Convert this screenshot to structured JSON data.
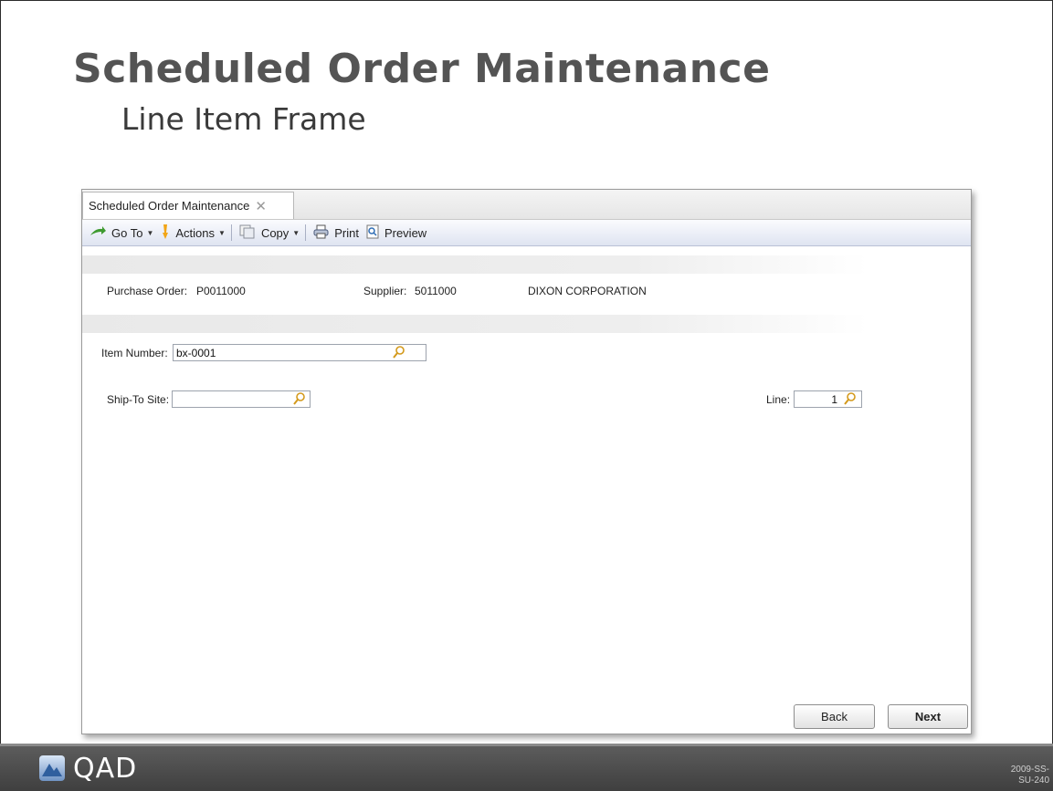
{
  "slide": {
    "title": "Scheduled Order Maintenance",
    "subtitle": "Line Item Frame",
    "code": "2009-SS-SU-240",
    "brand": "QAD"
  },
  "window": {
    "tab_label": "Scheduled Order Maintenance",
    "tab_close": "✕"
  },
  "toolbar": {
    "goto_label": "Go To",
    "actions_label": "Actions",
    "copy_label": "Copy",
    "print_label": "Print",
    "preview_label": "Preview"
  },
  "header": {
    "po_label": "Purchase Order:",
    "po_value": "P0011000",
    "supplier_label": "Supplier:",
    "supplier_value": "5011000",
    "supplier_name": "DIXON CORPORATION"
  },
  "form": {
    "item_number_label": "Item Number:",
    "item_number_value": "bx-0001",
    "ship_to_label": "Ship-To Site:",
    "ship_to_value": "",
    "line_label": "Line:",
    "line_value": "1"
  },
  "buttons": {
    "back": "Back",
    "next": "Next"
  },
  "icons": {
    "goto": "go-to-arrow-icon",
    "actions": "actions-icon",
    "copy": "copy-icon",
    "print": "printer-icon",
    "preview": "preview-icon",
    "lookup": "magnifier-icon"
  },
  "colors": {
    "title": "#545454",
    "toolbar_gradient_end": "#dfe4f1",
    "bottom_bar": "#4a4a4a",
    "lookup_icon": "#d49a1c"
  }
}
